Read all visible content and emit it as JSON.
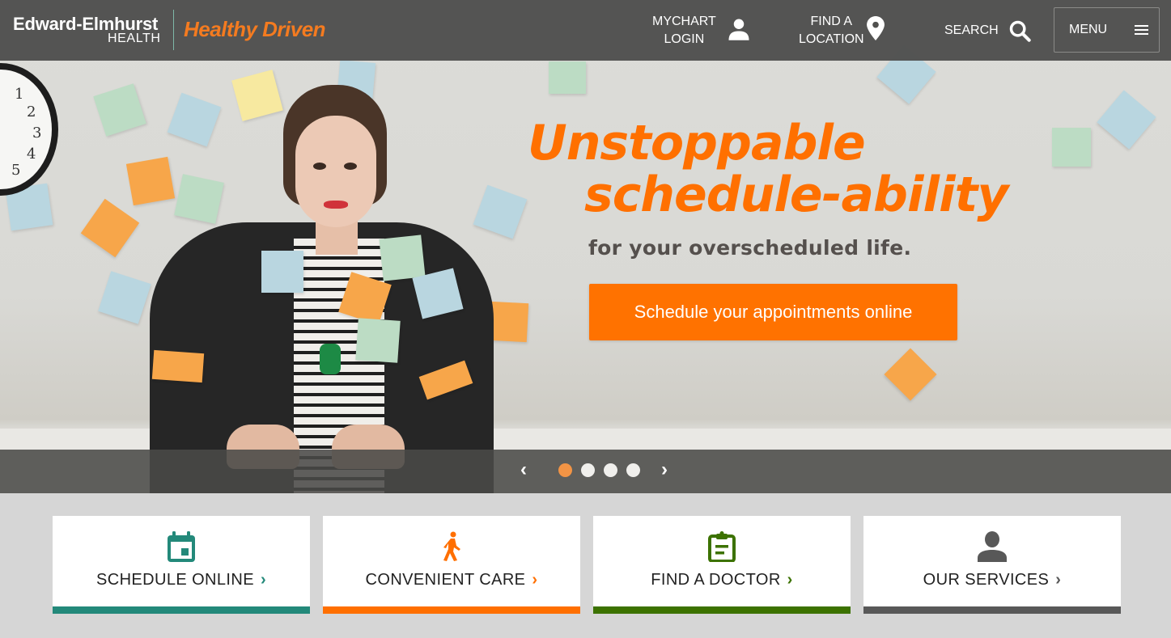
{
  "header": {
    "logo_name": "Edward-Elmhurst",
    "logo_sub": "HEALTH",
    "tagline": "Healthy Driven",
    "nav": [
      {
        "line1": "MYCHART",
        "line2": "LOGIN",
        "icon": "person-icon"
      },
      {
        "line1": "FIND A",
        "line2": "LOCATION",
        "icon": "map-pin-icon"
      },
      {
        "line1": "SEARCH",
        "icon": "search-icon"
      }
    ],
    "menu_label": "MENU"
  },
  "hero": {
    "headline_line1": "Unstoppable",
    "headline_line2": "schedule-ability",
    "subline": "for your overscheduled life.",
    "cta_label": "Schedule your appointments online",
    "clock_numbers": [
      "1",
      "2",
      "3",
      "4",
      "5"
    ],
    "carousel": {
      "prev": "‹",
      "next": "›",
      "slides": 4,
      "active_index": 0
    }
  },
  "cards": [
    {
      "label": "SCHEDULE ONLINE",
      "icon": "calendar-icon",
      "color": "#23897a"
    },
    {
      "label": "CONVENIENT CARE",
      "icon": "walking-person-icon",
      "color": "#ff6f00"
    },
    {
      "label": "FIND A DOCTOR",
      "icon": "clipboard-icon",
      "color": "#3c7200"
    },
    {
      "label": "OUR SERVICES",
      "icon": "person-icon",
      "color": "#585858"
    }
  ],
  "colors": {
    "brand_orange": "#ff7200",
    "header_bg": "#50504e",
    "teal": "#23897a",
    "green": "#3c7200",
    "gray": "#585858"
  }
}
